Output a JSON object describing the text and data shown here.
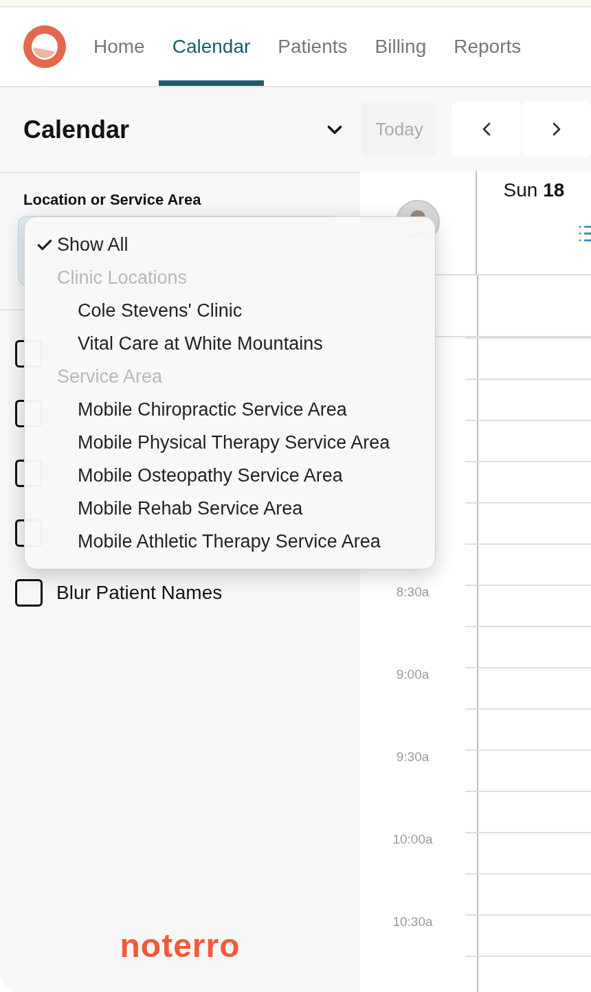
{
  "nav": {
    "tabs": [
      {
        "label": "Home",
        "selected": false
      },
      {
        "label": "Calendar",
        "selected": true
      },
      {
        "label": "Patients",
        "selected": false
      },
      {
        "label": "Billing",
        "selected": false
      },
      {
        "label": "Reports",
        "selected": false
      }
    ]
  },
  "sidebar": {
    "title": "Calendar",
    "location_label": "Location or Service Area",
    "checkboxes": [
      {
        "checked": false
      },
      {
        "checked": false
      },
      {
        "checked": false
      },
      {
        "checked": false
      },
      {
        "label": "Blur Patient Names",
        "checked": false
      }
    ],
    "logo": "noterro"
  },
  "dropdown": {
    "items": [
      {
        "kind": "option",
        "label": "Show All",
        "selected": true
      },
      {
        "kind": "group",
        "label": "Clinic Locations",
        "children": [
          {
            "kind": "option",
            "label": "Cole Stevens' Clinic",
            "selected": false
          },
          {
            "kind": "option",
            "label": "Vital Care at White Mountains",
            "selected": false
          }
        ]
      },
      {
        "kind": "group",
        "label": "Service Area",
        "children": [
          {
            "kind": "option",
            "label": "Mobile Chiropractic Service Area",
            "selected": false
          },
          {
            "kind": "option",
            "label": "Mobile Physical Therapy Service Area",
            "selected": false
          },
          {
            "kind": "option",
            "label": "Mobile Osteopathy Service Area",
            "selected": false
          },
          {
            "kind": "option",
            "label": "Mobile Rehab Service Area",
            "selected": false
          },
          {
            "kind": "option",
            "label": "Mobile Athletic Therapy Service Area",
            "selected": false
          }
        ]
      }
    ]
  },
  "calendar": {
    "today_button": "Today",
    "day_header": "Sun **18**",
    "times": [
      "8:30a",
      "9:00a",
      "9:30a",
      "10:00a",
      "10:30a"
    ]
  }
}
